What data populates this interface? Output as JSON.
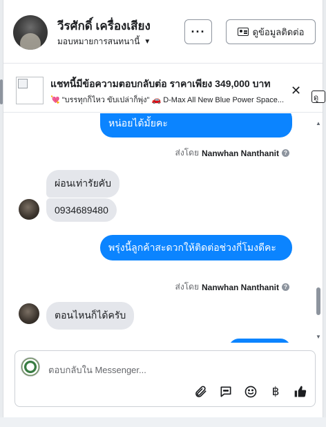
{
  "header": {
    "contact_name": "วีรศักดิ์ เครื่องเสียง",
    "assign_label": "มอบหมายการสนทนานี้",
    "more_label": "···",
    "contact_button_label": "ดูข้อมูลติดต่อ"
  },
  "ad_banner": {
    "title": "แชทนี้มีข้อความตอบกลับต่อ ราคาเพียง 349,000 บาท",
    "subtitle": "💘 \"บรรทุกก็ไหว ขับเปล่าก็พุ่ง\" 🚗 D-Max All New Blue Power Space...",
    "tag": "ดู"
  },
  "messages": [
    {
      "direction": "out",
      "text": "หน่อยได้มั้ยคะ"
    },
    {
      "direction": "meta",
      "prefix": "ส่งโดย",
      "sender": "Nanwhan Nanthanit"
    },
    {
      "direction": "in",
      "text": "ผ่อนเท่ารัยคับ"
    },
    {
      "direction": "in",
      "text": "0934689480"
    },
    {
      "direction": "out",
      "text": "พรุ่งนี้ลูกค้าสะดวกให้ติดต่อช่วงกี่โมงดีคะ"
    },
    {
      "direction": "meta",
      "prefix": "ส่งโดย",
      "sender": "Nanwhan Nanthanit"
    },
    {
      "direction": "in",
      "text": "ตอนไหนก็ได้ครับ"
    }
  ],
  "composer": {
    "placeholder": "ตอบกลับใน Messenger..."
  },
  "icons": [
    "card-icon",
    "close-icon",
    "info-icon",
    "attach-icon",
    "saved-reply-icon",
    "emoji-icon",
    "baht-icon",
    "like-icon"
  ],
  "colors": {
    "outgoing_bubble": "#0b84ff",
    "incoming_bubble": "#e4e6eb",
    "like_button": "#1c1e21"
  }
}
